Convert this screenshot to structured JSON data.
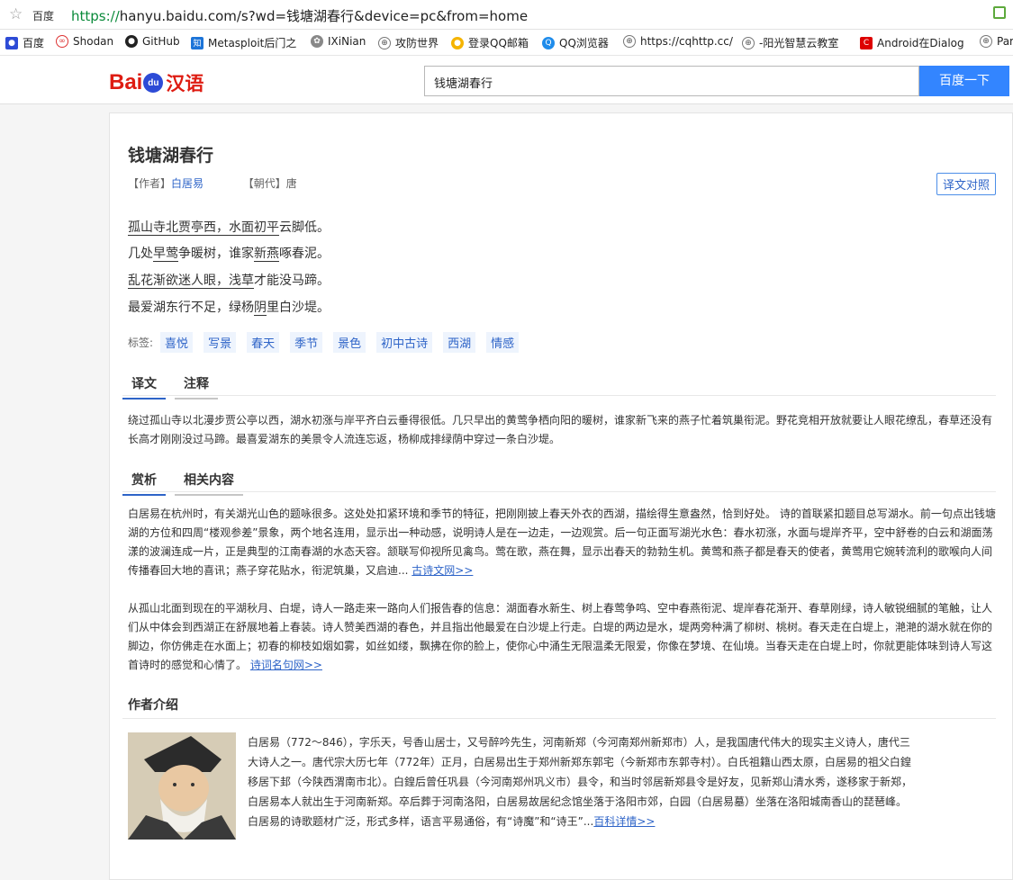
{
  "browser": {
    "site_label": "百度",
    "url_scheme": "https://",
    "url_rest": "hanyu.baidu.com/s?wd=钱塘湖春行&device=pc&from=home",
    "bookmarks": [
      {
        "label": "百度",
        "icon": "paw-icon"
      },
      {
        "label": "Shodan",
        "icon": "shodan-icon"
      },
      {
        "label": "GitHub",
        "icon": "github-icon"
      },
      {
        "label": "Metasploit后门之",
        "icon": "zhihu-icon"
      },
      {
        "label": "IXiNian",
        "icon": "leaf-icon"
      },
      {
        "label": "攻防世界",
        "icon": "globe-icon"
      },
      {
        "label": "登录QQ邮箱",
        "icon": "qqmail-icon"
      },
      {
        "label": "QQ浏览器",
        "icon": "qqbrowser-icon"
      },
      {
        "label": "https://cqhttp.cc/",
        "icon": "globe-icon"
      },
      {
        "label": "-阳光智慧云教室",
        "icon": "globe-icon"
      },
      {
        "label": "Android在Dialog",
        "icon": "csdn-icon"
      },
      {
        "label": "Par",
        "icon": "globe-icon"
      }
    ]
  },
  "header": {
    "logo_bai": "Bai",
    "logo_du": "du",
    "logo_zh": "汉语",
    "search_value": "钱塘湖春行",
    "search_button": "百度一下"
  },
  "poem": {
    "title": "钱塘湖春行",
    "author_label": "【作者】",
    "author": "白居易",
    "dynasty_label": "【朝代】",
    "dynasty": "唐",
    "compare_button": "译文对照",
    "lines": [
      [
        "孤山寺北贾亭西，",
        "水面初平",
        "云脚低。"
      ],
      [
        "几处",
        "早莺",
        "争暖树，谁家",
        "新燕",
        "啄春泥。"
      ],
      [
        "乱花渐欲迷人眼，",
        "浅草",
        "才能没马蹄。"
      ],
      [
        "最爱湖东行不足，绿杨",
        "阴",
        "里白沙堤。"
      ]
    ],
    "tags_label": "标签:",
    "tags": [
      "喜悦",
      "写景",
      "春天",
      "季节",
      "景色",
      "初中古诗",
      "西湖",
      "情感"
    ]
  },
  "tabs1": [
    "译文",
    "注释"
  ],
  "translation": "绕过孤山寺以北漫步贾公亭以西，湖水初涨与岸平齐白云垂得很低。几只早出的黄莺争栖向阳的暖树，谁家新飞来的燕子忙着筑巢衔泥。野花竞相开放就要让人眼花缭乱，春草还没有长高才刚刚没过马蹄。最喜爱湖东的美景令人流连忘返，杨柳成排绿荫中穿过一条白沙堤。",
  "tabs2": [
    "赏析",
    "相关内容"
  ],
  "analysis1": "白居易在杭州时，有关湖光山色的题咏很多。这处处扣紧环境和季节的特征，把刚刚披上春天外衣的西湖，描绘得生意盎然，恰到好处。 诗的首联紧扣题目总写湖水。前一句点出钱塘湖的方位和四周“楼观参差”景象，两个地名连用，显示出一种动感，说明诗人是在一边走，一边观赏。后一句正面写湖光水色：春水初涨，水面与堤岸齐平，空中舒卷的白云和湖面荡漾的波澜连成一片，正是典型的江南春湖的水态天容。颔联写仰视所见禽鸟。莺在歌，燕在舞，显示出春天的勃勃生机。黄莺和燕子都是春天的使者，黄莺用它婉转流利的歌喉向人间传播春回大地的喜讯；燕子穿花贴水，衔泥筑巢，又启迪...",
  "analysis1_link": "古诗文网>>",
  "analysis2": "从孤山北面到现在的平湖秋月、白堤，诗人一路走来一路向人们报告春的信息：湖面春水新生、树上春莺争鸣、空中春燕衔泥、堤岸春花渐开、春草刚绿，诗人敏锐细腻的笔触，让人们从中体会到西湖正在舒展地着上春装。诗人赞美西湖的春色，并且指出他最爱在白沙堤上行走。白堤的两边是水，堤两旁种满了柳树、桃树。春天走在白堤上，滟滟的湖水就在你的脚边，你仿佛走在水面上；初春的柳枝如烟如雾，如丝如缕，飘拂在你的脸上，使你心中涌生无限温柔无限爱，你像在梦境、在仙境。当春天走在白堤上时，你就更能体味到诗人写这首诗时的感觉和心情了。",
  "analysis2_link": "诗词名句网>>",
  "author_section": {
    "heading": "作者介绍",
    "bio": "白居易（772～846），字乐天，号香山居士，又号醉吟先生，河南新郑（今河南郑州新郑市）人，是我国唐代伟大的现实主义诗人，唐代三大诗人之一。唐代宗大历七年（772年）正月，白居易出生于郑州新郑东郭宅（今新郑市东郭寺村）。白氏祖籍山西太原，白居易的祖父白鍠移居下邽（今陕西渭南市北）。白鍠后曾任巩县（今河南郑州巩义市）县令，和当时邻居新郑县令是好友，见新郑山清水秀，遂移家于新郑，白居易本人就出生于河南新郑。卒后葬于河南洛阳，白居易故居纪念馆坐落于洛阳市郊，白园（白居易墓）坐落在洛阳城南香山的琵琶峰。白居易的诗歌题材广泛，形式多样，语言平易通俗，有“诗魔”和“诗王”...",
    "link": "百科详情>>"
  },
  "colors": {
    "accent": "#2e64c8",
    "button": "#3385ff",
    "logo_red": "#de1c12",
    "logo_blue": "#2d4bd6"
  }
}
